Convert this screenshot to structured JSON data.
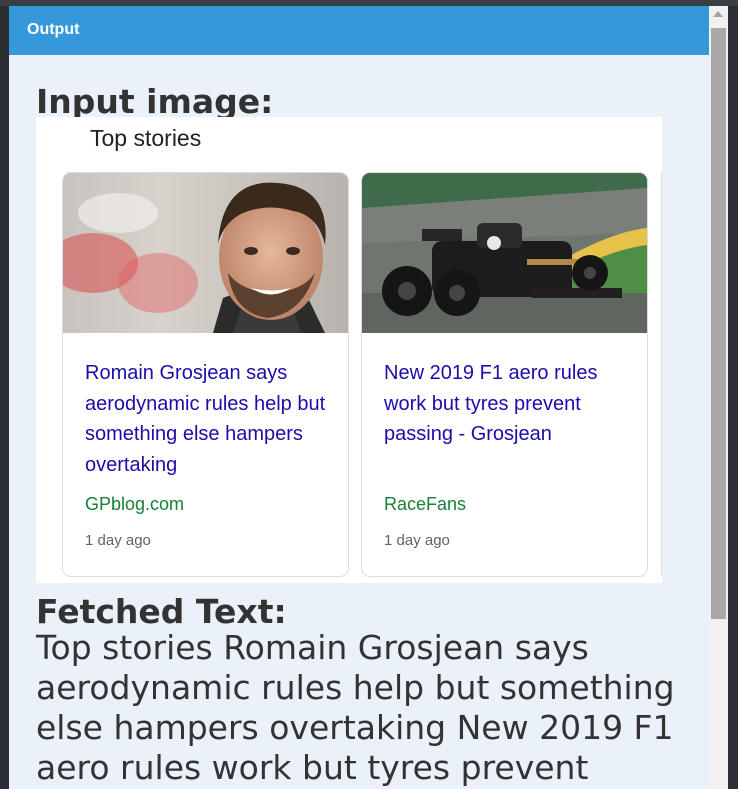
{
  "modal": {
    "title": "Output"
  },
  "sections": {
    "input_heading": "Input image:",
    "fetched_heading": "Fetched Text:",
    "fetched_text": "Top stories Romain Grosjean says aerodynamic rules help but something else hampers overtaking New 2019 F1 aero rules work but tyres prevent"
  },
  "panel": {
    "title": "Top stories",
    "cards": [
      {
        "headline": "Romain Grosjean says aerodynamic rules help but something else hampers overtaking",
        "source": "GPblog.com",
        "time": "1 day ago",
        "image": "portrait-photo"
      },
      {
        "headline": "New 2019 F1 aero rules work but tyres prevent passing - Grosjean",
        "source": "RaceFans",
        "time": "1 day ago",
        "image": "f1-car-photo"
      }
    ]
  }
}
